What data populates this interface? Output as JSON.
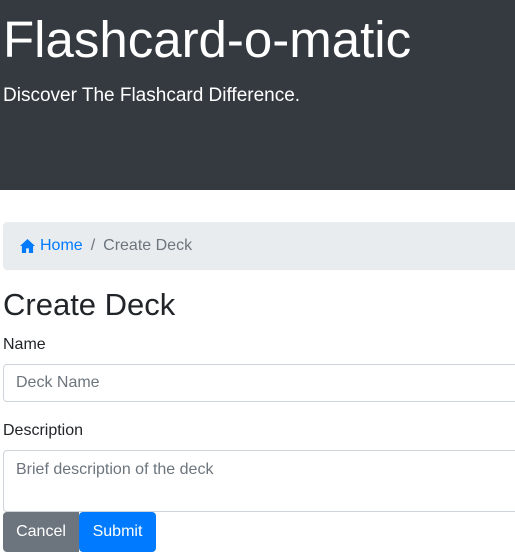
{
  "header": {
    "title": "Flashcard-o-matic",
    "subtitle": "Discover The Flashcard Difference."
  },
  "breadcrumb": {
    "home_label": "Home",
    "separator": "/",
    "current_label": "Create Deck",
    "home_icon": "home-icon"
  },
  "page": {
    "title": "Create Deck"
  },
  "form": {
    "name_label": "Name",
    "name_placeholder": "Deck Name",
    "name_value": "",
    "description_label": "Description",
    "description_placeholder": "Brief description of the deck",
    "description_value": "",
    "cancel_label": "Cancel",
    "submit_label": "Submit"
  },
  "colors": {
    "header_bg": "#343a40",
    "link": "#007bff",
    "breadcrumb_bg": "#e9ecef",
    "secondary_button": "#6c757d",
    "primary_button": "#007bff"
  }
}
